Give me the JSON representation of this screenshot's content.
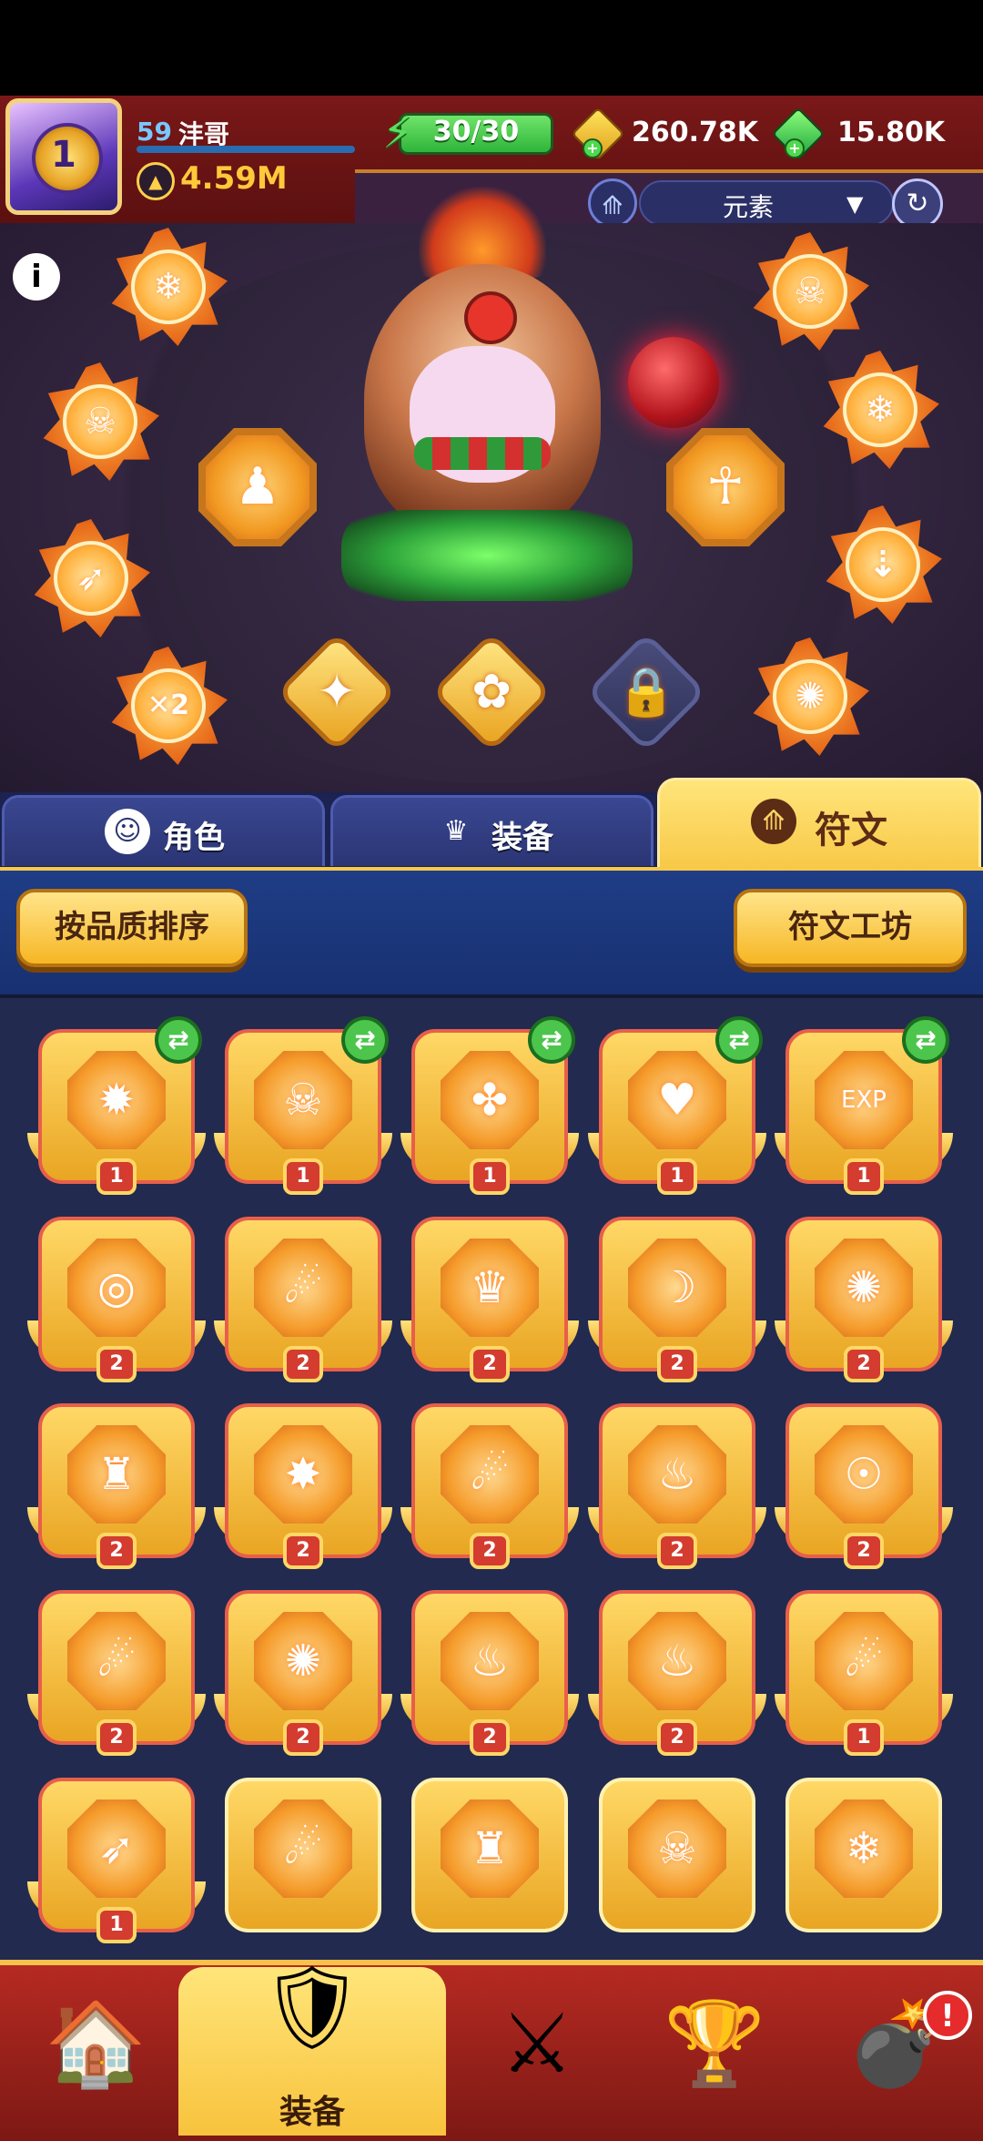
{
  "header": {
    "player_level": "59",
    "player_name": "沣哥",
    "power": "4.59M",
    "energy": "30/30",
    "gold": "260.78K",
    "gems": "15.80K",
    "avatar_level": "1"
  },
  "filter": {
    "selected": "元素"
  },
  "tabs": [
    {
      "label": "角色",
      "icon": "character-icon"
    },
    {
      "label": "装备",
      "icon": "armor-icon"
    },
    {
      "label": "符文",
      "icon": "rune-icon",
      "active": true
    }
  ],
  "toolbar": {
    "sort_button": "按品质排序",
    "workshop_button": "符文工坊"
  },
  "rune_grid": [
    {
      "glyph": "✹",
      "level": "1",
      "sync": true
    },
    {
      "glyph": "☠",
      "level": "1",
      "sync": true
    },
    {
      "glyph": "✤",
      "level": "1",
      "sync": true
    },
    {
      "glyph": "♥",
      "level": "1",
      "sync": true
    },
    {
      "glyph": "EXP",
      "level": "1",
      "sync": true
    },
    {
      "glyph": "◎",
      "level": "2"
    },
    {
      "glyph": "☄",
      "level": "2"
    },
    {
      "glyph": "♛",
      "level": "2"
    },
    {
      "glyph": "☽",
      "level": "2"
    },
    {
      "glyph": "✺",
      "level": "2"
    },
    {
      "glyph": "♜",
      "level": "2"
    },
    {
      "glyph": "✸",
      "level": "2"
    },
    {
      "glyph": "☄",
      "level": "2"
    },
    {
      "glyph": "♨",
      "level": "2"
    },
    {
      "glyph": "☉",
      "level": "2"
    },
    {
      "glyph": "☄",
      "level": "2"
    },
    {
      "glyph": "✺",
      "level": "2"
    },
    {
      "glyph": "♨",
      "level": "2"
    },
    {
      "glyph": "♨",
      "level": "2"
    },
    {
      "glyph": "☄",
      "level": "1"
    },
    {
      "glyph": "➶",
      "level": "1"
    },
    {
      "glyph": "☄",
      "level": ""
    },
    {
      "glyph": "♜",
      "level": ""
    },
    {
      "glyph": "☠",
      "level": ""
    },
    {
      "glyph": "❄",
      "level": ""
    }
  ],
  "equipped": {
    "orbit": [
      "❄",
      "☠",
      "➶",
      "✕2",
      "☠",
      "❄",
      "⇣",
      "✺"
    ],
    "center": [
      "♟",
      "☥"
    ],
    "diamonds": [
      "✦",
      "✿",
      "🔒"
    ]
  },
  "bottom_nav": {
    "active_label": "装备",
    "notification_badge": "!"
  }
}
